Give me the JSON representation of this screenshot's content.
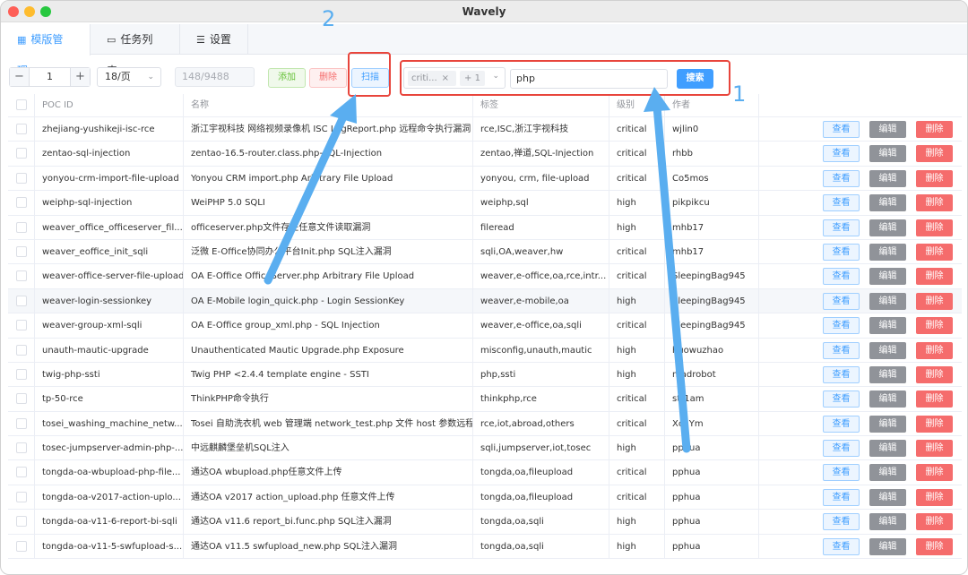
{
  "window": {
    "title": "Wavely"
  },
  "tabs": [
    {
      "label": "模版管理",
      "icon": "grid-icon"
    },
    {
      "label": "任务列表",
      "icon": "folder-icon"
    },
    {
      "label": "设置",
      "icon": "sliders-icon"
    }
  ],
  "toolbar": {
    "page_value": "1",
    "page_size": "18/页",
    "totals": "148/9488",
    "add_label": "添加",
    "delete_label": "删除",
    "scan_label": "扫描",
    "filter_tag": "criti...",
    "filter_more": "+ 1",
    "search_value": "php",
    "search_label": "搜索"
  },
  "annotations": {
    "label_1": "1",
    "label_2": "2"
  },
  "table": {
    "headers": {
      "id": "POC ID",
      "name": "名称",
      "tags": "标签",
      "level": "级别",
      "author": "作者"
    },
    "actions": {
      "view": "查看",
      "edit": "编辑",
      "delete": "删除"
    },
    "rows": [
      {
        "id": "zhejiang-yushikeji-isc-rce",
        "name": "浙江宇视科技 网络视频录像机 ISC LogReport.php 远程命令执行漏洞",
        "tags": "rce,ISC,浙江宇视科技",
        "level": "critical",
        "author": "wjlin0"
      },
      {
        "id": "zentao-sql-injection",
        "name": "zentao-16.5-router.class.php-SQL-Injection",
        "tags": "zentao,禅道,SQL-Injection",
        "level": "critical",
        "author": "rhbb"
      },
      {
        "id": "yonyou-crm-import-file-upload",
        "name": "Yonyou CRM import.php Arbitrary File Upload",
        "tags": "yonyou, crm, file-upload",
        "level": "critical",
        "author": "Co5mos"
      },
      {
        "id": "weiphp-sql-injection",
        "name": "WeiPHP 5.0 SQLI",
        "tags": "weiphp,sql",
        "level": "high",
        "author": "pikpikcu"
      },
      {
        "id": "weaver_office_officeserver_fil...",
        "name": "officeserver.php文件存在任意文件读取漏洞",
        "tags": "fileread",
        "level": "high",
        "author": "mhb17"
      },
      {
        "id": "weaver_eoffice_init_sqli",
        "name": "泛微 E-Office协同办公平台Init.php SQL注入漏洞",
        "tags": "sqli,OA,weaver,hw",
        "level": "critical",
        "author": "mhb17"
      },
      {
        "id": "weaver-office-server-file-upload",
        "name": "OA E-Office OfficeServer.php Arbitrary File Upload",
        "tags": "weaver,e-office,oa,rce,intr...",
        "level": "critical",
        "author": "SleepingBag945"
      },
      {
        "id": "weaver-login-sessionkey",
        "name": "OA E-Mobile login_quick.php - Login SessionKey",
        "tags": "weaver,e-mobile,oa",
        "level": "high",
        "author": "SleepingBag945"
      },
      {
        "id": "weaver-group-xml-sqli",
        "name": "OA E-Office group_xml.php - SQL Injection",
        "tags": "weaver,e-office,oa,sqli",
        "level": "critical",
        "author": "SleepingBag945"
      },
      {
        "id": "unauth-mautic-upgrade",
        "name": "Unauthenticated Mautic Upgrade.php Exposure",
        "tags": "misconfig,unauth,mautic",
        "level": "high",
        "author": "huowuzhao"
      },
      {
        "id": "twig-php-ssti",
        "name": "Twig PHP <2.4.4 template engine - SSTI",
        "tags": "php,ssti",
        "level": "high",
        "author": "madrobot"
      },
      {
        "id": "tp-50-rce",
        "name": "ThinkPHP命令执行",
        "tags": "thinkphp,rce",
        "level": "critical",
        "author": "str1am"
      },
      {
        "id": "tosei_washing_machine_netw...",
        "name": "Tosei 自助洗衣机 web 管理端 network_test.php 文件 host 参数远程...",
        "tags": "rce,iot,abroad,others",
        "level": "critical",
        "author": "Xc1Ym"
      },
      {
        "id": "tosec-jumpserver-admin-php-...",
        "name": "中远麒麟堡垒机SQL注入",
        "tags": "sqli,jumpserver,iot,tosec",
        "level": "high",
        "author": "pphua"
      },
      {
        "id": "tongda-oa-wbupload-php-file...",
        "name": "通达OA wbupload.php任意文件上传",
        "tags": "tongda,oa,fileupload",
        "level": "critical",
        "author": "pphua"
      },
      {
        "id": "tongda-oa-v2017-action-uplo...",
        "name": "通达OA v2017 action_upload.php 任意文件上传",
        "tags": "tongda,oa,fileupload",
        "level": "critical",
        "author": "pphua"
      },
      {
        "id": "tongda-oa-v11-6-report-bi-sqli",
        "name": "通达OA v11.6 report_bi.func.php SQL注入漏洞",
        "tags": "tongda,oa,sqli",
        "level": "high",
        "author": "pphua"
      },
      {
        "id": "tongda-oa-v11-5-swfupload-s...",
        "name": "通达OA v11.5 swfupload_new.php SQL注入漏洞",
        "tags": "tongda,oa,sqli",
        "level": "high",
        "author": "pphua"
      }
    ]
  },
  "colors": {
    "primary": "#409eff",
    "danger": "#f56c6c",
    "info": "#909399",
    "success": "#67c23a",
    "annotation_red": "#e8453c",
    "annotation_blue": "#5aaef0"
  }
}
